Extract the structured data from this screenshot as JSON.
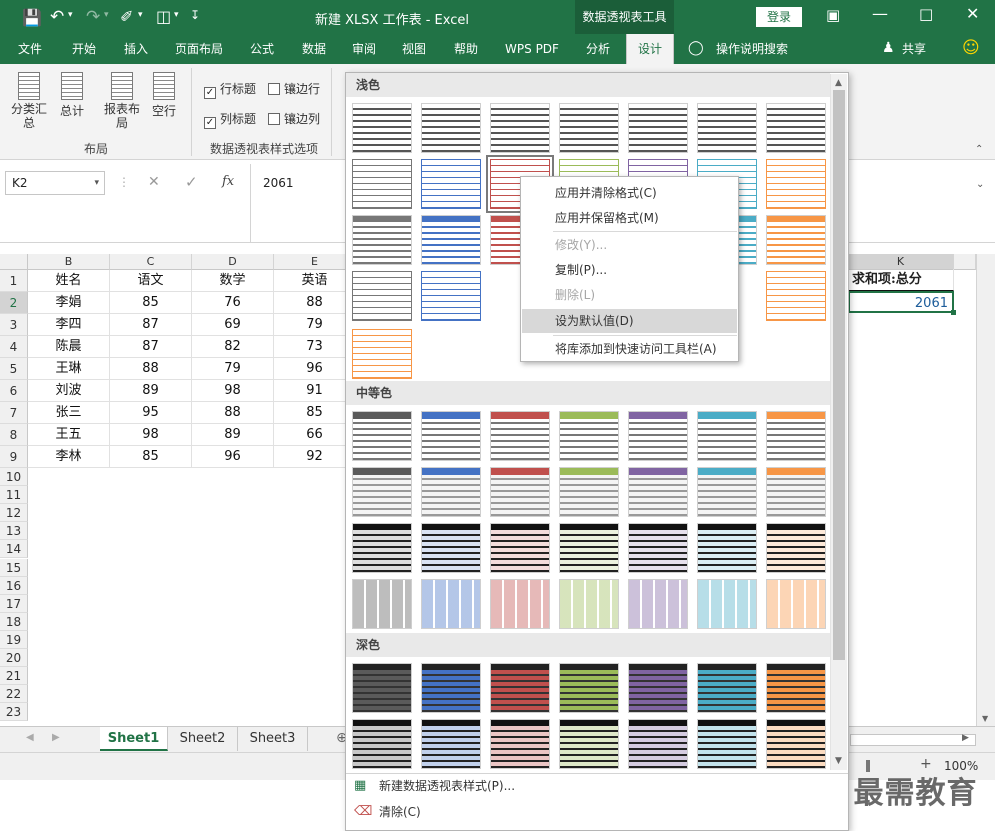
{
  "window": {
    "title": "新建 XLSX 工作表  -  Excel",
    "context_tab": "数据透视表工具",
    "login": "登录"
  },
  "qat": {
    "save_icon": "save-icon",
    "undo_icon": "undo-icon",
    "redo_icon": "redo-icon",
    "format_icon": "format-painter-icon",
    "preview_icon": "print-preview-icon",
    "more_icon": "customize-icon"
  },
  "ribbon_tabs": [
    "文件",
    "开始",
    "插入",
    "页面布局",
    "公式",
    "数据",
    "审阅",
    "视图",
    "帮助",
    "WPS PDF",
    "分析",
    "设计"
  ],
  "tell_me": "操作说明搜索",
  "share": "共享",
  "ribbon": {
    "buttons": [
      {
        "label": "分类汇\n总"
      },
      {
        "label": "总计"
      },
      {
        "label": "报表布\n局"
      },
      {
        "label": "空行"
      }
    ],
    "group_layout": "布局",
    "checks": [
      {
        "label": "行标题",
        "checked": true
      },
      {
        "label": "镶边行",
        "checked": false
      },
      {
        "label": "列标题",
        "checked": true
      },
      {
        "label": "镶边列",
        "checked": false
      }
    ],
    "group_style_options": "数据透视表样式选项"
  },
  "formula_bar": {
    "name_box": "K2",
    "fx": "fx",
    "value": "2061"
  },
  "grid": {
    "col_headers": [
      "B",
      "C",
      "D",
      "E"
    ],
    "k_header": "K",
    "row_numbers": [
      "1",
      "2",
      "3",
      "4",
      "5",
      "6",
      "7",
      "8",
      "9",
      "10",
      "11",
      "12",
      "13",
      "14",
      "15",
      "16",
      "17",
      "18",
      "19",
      "20",
      "21",
      "22",
      "23"
    ],
    "headers": [
      "姓名",
      "语文",
      "数学",
      "英语"
    ],
    "rows": [
      [
        "李娟",
        "85",
        "76",
        "88"
      ],
      [
        "李四",
        "87",
        "69",
        "79"
      ],
      [
        "陈晨",
        "87",
        "82",
        "73"
      ],
      [
        "王琳",
        "88",
        "79",
        "96"
      ],
      [
        "刘波",
        "89",
        "98",
        "91"
      ],
      [
        "张三",
        "95",
        "88",
        "85"
      ],
      [
        "王五",
        "98",
        "89",
        "66"
      ],
      [
        "李林",
        "85",
        "96",
        "92"
      ]
    ],
    "pivot_label": "求和项:总分",
    "pivot_value": "2061"
  },
  "sheets": [
    "Sheet1",
    "Sheet2",
    "Sheet3"
  ],
  "status": {
    "zoom": "100%"
  },
  "gallery": {
    "light": "浅色",
    "medium": "中等色",
    "dark": "深色",
    "new_style": "新建数据透视表样式(P)...",
    "clear": "清除(C)",
    "palette": [
      "#5a5a5a",
      "#4472c4",
      "#c0504d",
      "#9bbb59",
      "#8064a2",
      "#4bacc6",
      "#f79646"
    ]
  },
  "context_menu": [
    {
      "label": "应用并清除格式(C)",
      "disabled": false
    },
    {
      "label": "应用并保留格式(M)",
      "disabled": false
    },
    {
      "label": "修改(Y)...",
      "disabled": true
    },
    {
      "label": "复制(P)...",
      "disabled": false
    },
    {
      "label": "删除(L)",
      "disabled": true
    },
    {
      "label": "设为默认值(D)",
      "disabled": false,
      "highlighted": true
    },
    {
      "label": "将库添加到快速访问工具栏(A)",
      "disabled": false
    }
  ],
  "watermark": "最需教育"
}
